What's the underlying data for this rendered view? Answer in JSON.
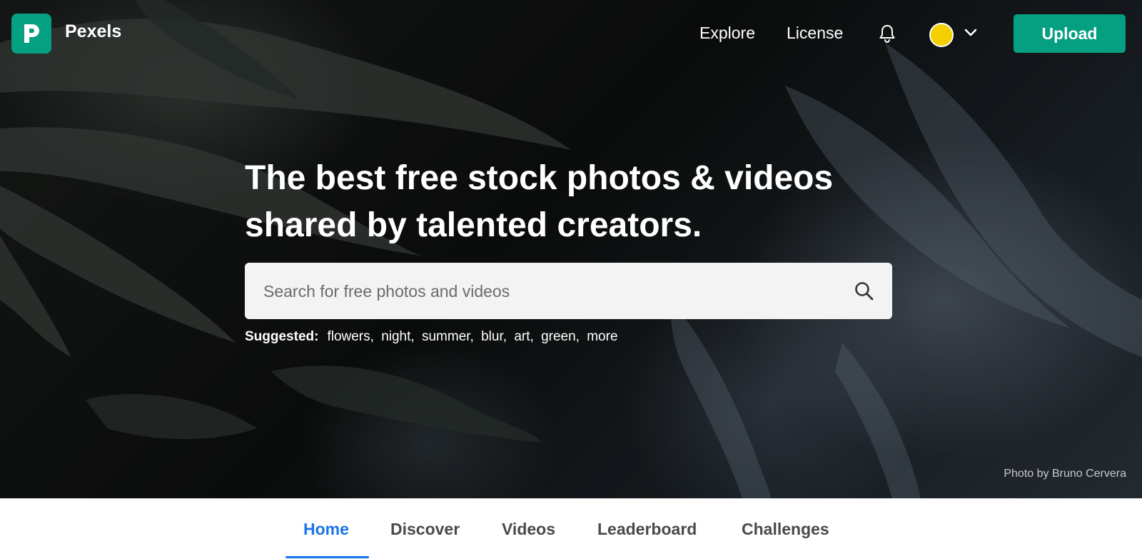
{
  "brand": {
    "name": "Pexels",
    "accent": "#05a081"
  },
  "nav": {
    "explore": "Explore",
    "license": "License",
    "bell_icon": "bell-icon",
    "avatar_color": "#f5cf00",
    "menu_icon": "chevron-down-icon",
    "upload": "Upload"
  },
  "hero": {
    "headline_line1": "The best free stock photos & videos",
    "headline_line2": "shared by talented creators.",
    "search_placeholder": "Search for free photos and videos",
    "search_icon": "search-icon",
    "suggested_label": "Suggested:",
    "suggestions": [
      "flowers",
      "night",
      "summer",
      "blur",
      "art",
      "green",
      "more"
    ],
    "photo_credit": "Photo by Bruno Cervera"
  },
  "tabs": [
    {
      "label": "Home",
      "active": true
    },
    {
      "label": "Discover",
      "active": false
    },
    {
      "label": "Videos",
      "active": false
    },
    {
      "label": "Leaderboard",
      "active": false
    },
    {
      "label": "Challenges",
      "active": false
    }
  ],
  "colors": {
    "active_tab": "#1a73e8"
  }
}
